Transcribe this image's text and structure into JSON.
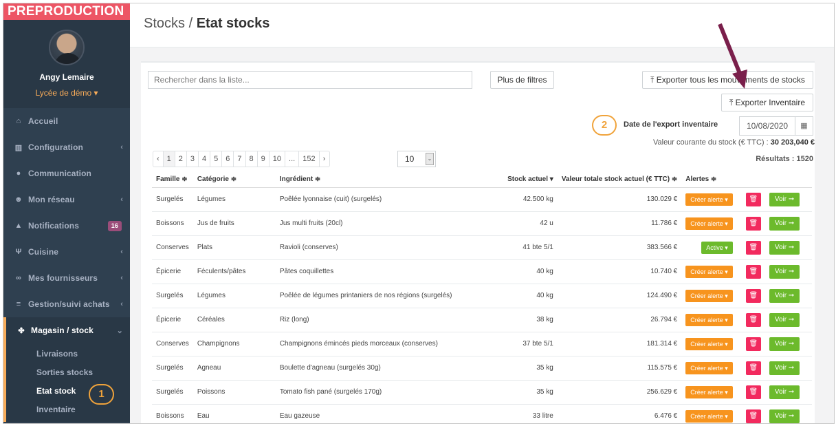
{
  "env_banner": "PREPRODUCTION",
  "user": {
    "name": "Angy Lemaire",
    "school": "Lycée de démo ▾"
  },
  "nav": [
    {
      "label": "Accueil",
      "icon": "home-icon",
      "glyph": "⌂",
      "chev": ""
    },
    {
      "label": "Configuration",
      "icon": "bank-icon",
      "glyph": "▥",
      "chev": "‹"
    },
    {
      "label": "Communication",
      "icon": "chat-icon",
      "glyph": "●",
      "chev": ""
    },
    {
      "label": "Mon réseau",
      "icon": "users-icon",
      "glyph": "☻",
      "chev": "‹"
    },
    {
      "label": "Notifications",
      "icon": "bell-icon",
      "glyph": "▲",
      "chev": "",
      "badge": "16"
    },
    {
      "label": "Cuisine",
      "icon": "cutlery-icon",
      "glyph": "Ψ",
      "chev": "‹"
    },
    {
      "label": "Mes fournisseurs",
      "icon": "handshake-icon",
      "glyph": "∞",
      "chev": "‹"
    },
    {
      "label": "Gestion/suivi achats",
      "icon": "cart-icon",
      "glyph": "≡",
      "chev": "‹"
    }
  ],
  "active_nav": {
    "label": "Magasin / stock",
    "icon": "cubes-icon",
    "glyph": "✤",
    "chev": "⌄"
  },
  "subnav": [
    "Livraisons",
    "Sorties stocks",
    "Etat stock",
    "Inventaire"
  ],
  "marker1": "1",
  "marker2": "2",
  "breadcrumb": {
    "parent": "Stocks / ",
    "current": "Etat stocks"
  },
  "search_placeholder": "Rechercher dans la liste...",
  "btn_filters": "Plus de filtres",
  "btn_export_moves": "⤒ Exporter tous les mouvements de stocks",
  "btn_export_inv": "⤒ Exporter Inventaire",
  "date_label": "Date de l'export inventaire",
  "date_value": "10/08/2020",
  "valeur_label": "Valeur courante du stock (€ TTC) : ",
  "valeur_value": "30 203,040 €",
  "pagination": [
    "‹",
    "1",
    "2",
    "3",
    "4",
    "5",
    "6",
    "7",
    "8",
    "9",
    "10",
    "...",
    "152",
    "›"
  ],
  "per_page": "10",
  "results": "Résultats : 1520",
  "columns": [
    "Famille ≑",
    "Catégorie ≑",
    "Ingrédient ≑",
    "Stock actuel ▾",
    "Valeur totale stock actuel (€ TTC) ≑",
    "Alertes ≑"
  ],
  "rows": [
    {
      "famille": "Surgelés",
      "categorie": "Légumes",
      "ingredient": "Poêlée lyonnaise (cuit) (surgelés)",
      "stock": "42.500 kg",
      "valeur": "130.029 €",
      "alerte": "Créer alerte ▾",
      "active": false
    },
    {
      "famille": "Boissons",
      "categorie": "Jus de fruits",
      "ingredient": "Jus multi fruits (20cl)",
      "stock": "42 u",
      "valeur": "11.786 €",
      "alerte": "Créer alerte ▾",
      "active": false
    },
    {
      "famille": "Conserves",
      "categorie": "Plats",
      "ingredient": "Ravioli (conserves)",
      "stock": "41 bte 5/1",
      "valeur": "383.566 €",
      "alerte": "Active ▾",
      "active": true
    },
    {
      "famille": "Épicerie",
      "categorie": "Féculents/pâtes",
      "ingredient": "Pâtes coquillettes",
      "stock": "40 kg",
      "valeur": "10.740 €",
      "alerte": "Créer alerte ▾",
      "active": false
    },
    {
      "famille": "Surgelés",
      "categorie": "Légumes",
      "ingredient": "Poêlée de légumes printaniers de nos régions (surgelés)",
      "stock": "40 kg",
      "valeur": "124.490 €",
      "alerte": "Créer alerte ▾",
      "active": false
    },
    {
      "famille": "Épicerie",
      "categorie": "Céréales",
      "ingredient": "Riz (long)",
      "stock": "38 kg",
      "valeur": "26.794 €",
      "alerte": "Créer alerte ▾",
      "active": false
    },
    {
      "famille": "Conserves",
      "categorie": "Champignons",
      "ingredient": "Champignons émincés pieds morceaux (conserves)",
      "stock": "37 bte 5/1",
      "valeur": "181.314 €",
      "alerte": "Créer alerte ▾",
      "active": false
    },
    {
      "famille": "Surgelés",
      "categorie": "Agneau",
      "ingredient": "Boulette d'agneau (surgelés 30g)",
      "stock": "35 kg",
      "valeur": "115.575 €",
      "alerte": "Créer alerte ▾",
      "active": false
    },
    {
      "famille": "Surgelés",
      "categorie": "Poissons",
      "ingredient": "Tomato fish pané (surgelés 170g)",
      "stock": "35 kg",
      "valeur": "256.629 €",
      "alerte": "Créer alerte ▾",
      "active": false
    },
    {
      "famille": "Boissons",
      "categorie": "Eau",
      "ingredient": "Eau gazeuse",
      "stock": "33 litre",
      "valeur": "6.476 €",
      "alerte": "Créer alerte ▾",
      "active": false
    }
  ],
  "voir_label": "Voir ➞",
  "delete_glyph": "🗑",
  "colors": {
    "sidebar": "#2f4050",
    "accent": "#f8ac59",
    "banner": "#ed5565",
    "alert": "#f7941e",
    "voir": "#6cba2c",
    "delete": "#f22a5e",
    "annotation_arrow": "#7a1f4b"
  }
}
